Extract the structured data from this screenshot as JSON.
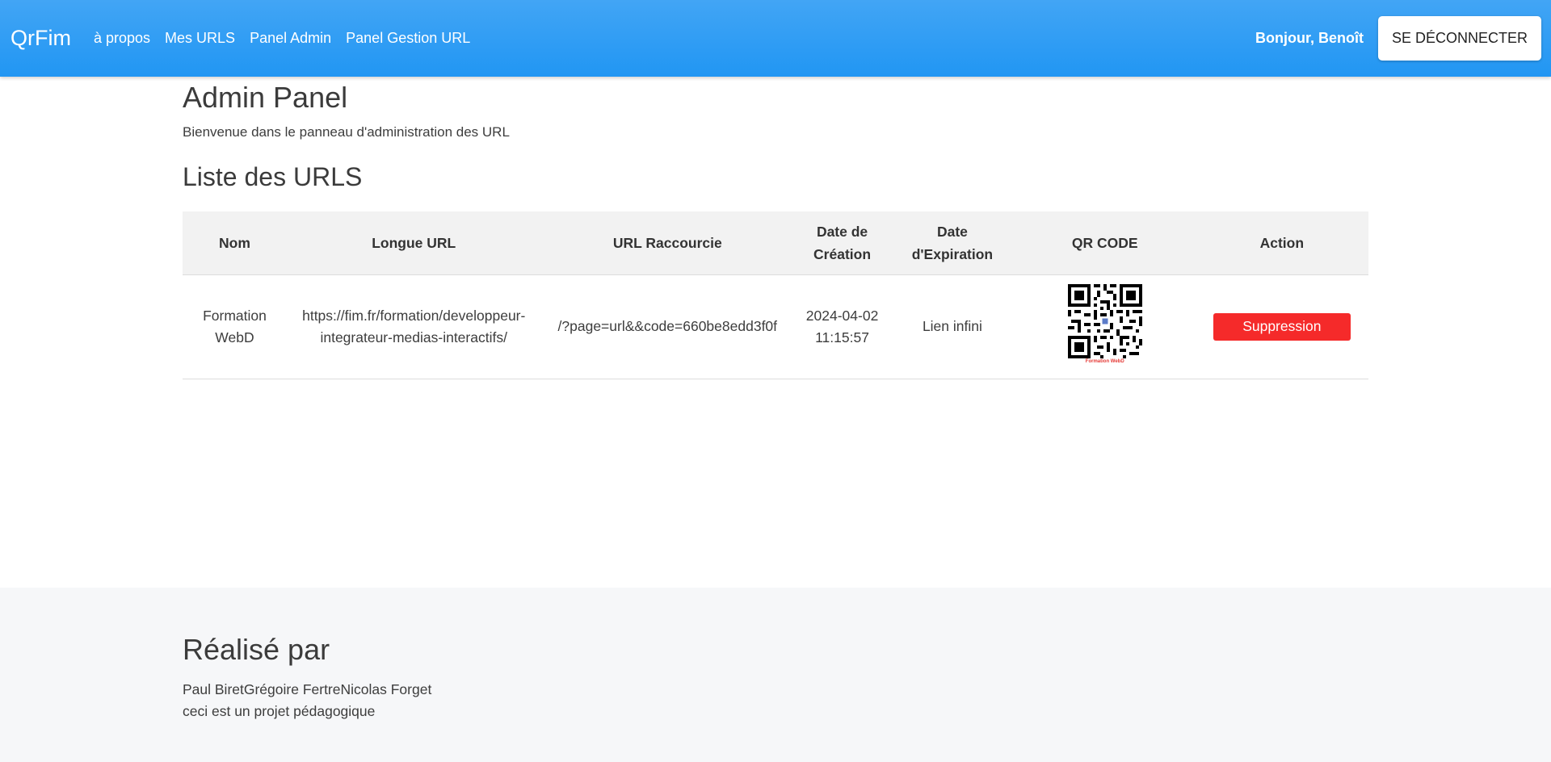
{
  "nav": {
    "brand": "QrFim",
    "links": [
      "à propos",
      "Mes URLS",
      "Panel Admin",
      "Panel Gestion URL"
    ],
    "greeting": "Bonjour, Benoît",
    "logout_label": "SE DÉCONNECTER"
  },
  "main": {
    "title": "Admin Panel",
    "subtitle": "Bienvenue dans le panneau d'administration des URL",
    "list_title": "Liste des URLS"
  },
  "table": {
    "headers": [
      "Nom",
      "Longue URL",
      "URL Raccourcie",
      "Date de Création",
      "Date d'Expiration",
      "QR CODE",
      "Action"
    ],
    "rows": [
      {
        "name": "Formation WebD",
        "long_url": "https://fim.fr/formation/developpeur-integrateur-medias-interactifs/",
        "short_url": "/?page=url&&code=660be8edd3f0f",
        "created": "2024-04-02 11:15:57",
        "expiration": "Lien infini",
        "qr_caption": "Formation WebD",
        "action_label": "Suppression"
      }
    ]
  },
  "footer": {
    "title": "Réalisé par",
    "authors": "Paul BiretGrégoire FertreNicolas Forget",
    "note": "ceci est un projet pédagogique"
  },
  "colors": {
    "navbar": "#2196f3",
    "delete_button": "#f52a2a",
    "footer_bg": "#f6f7f9"
  }
}
